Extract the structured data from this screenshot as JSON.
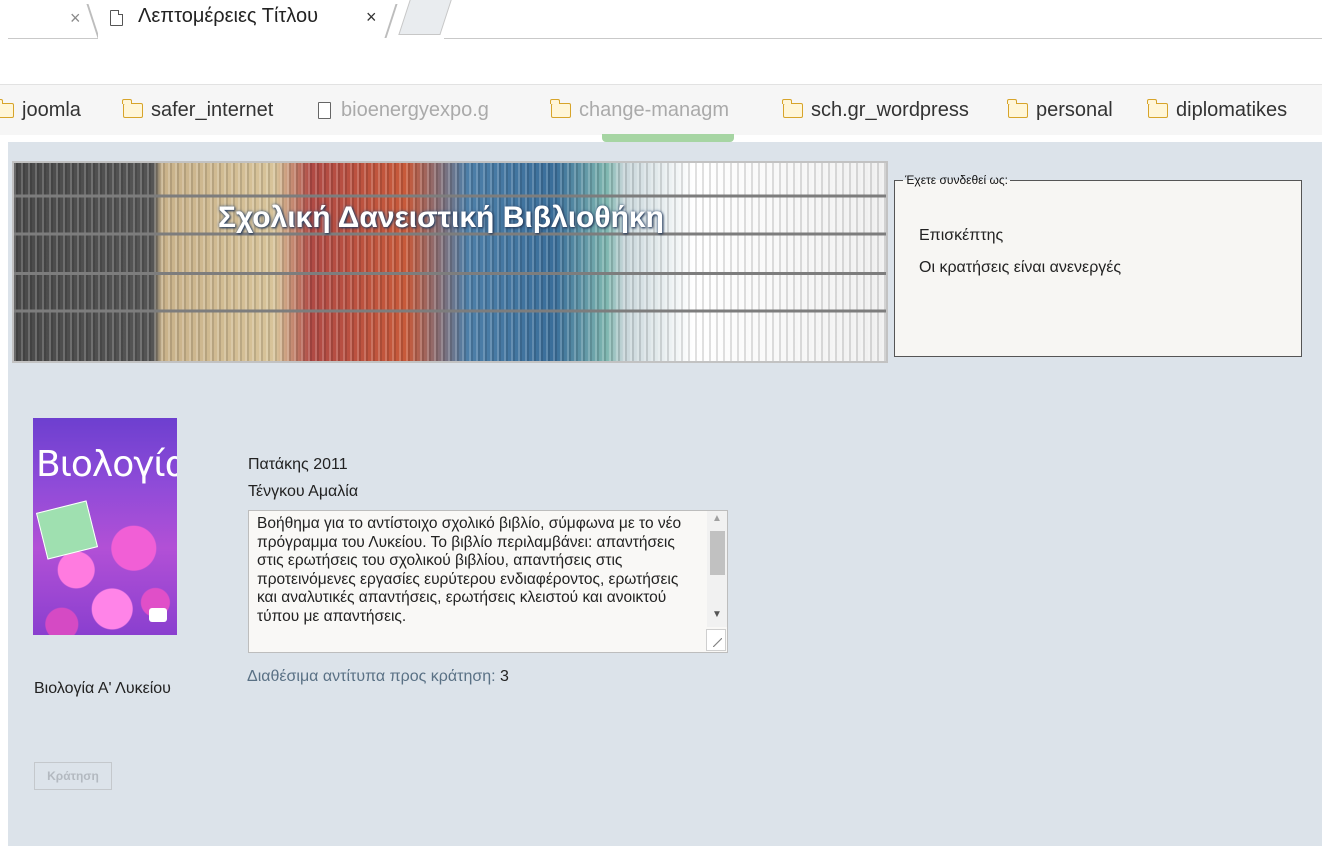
{
  "browser": {
    "active_tab_title": "Λεπτομέρειες Τίτλου",
    "close_symbol": "×",
    "bookmarks": [
      {
        "label": "joomla",
        "icon": "folder-icon"
      },
      {
        "label": "safer_internet",
        "icon": "folder-icon"
      },
      {
        "label": "bioenergyexpo.g",
        "icon": "page-icon"
      },
      {
        "label": "change-managm",
        "icon": "folder-icon"
      },
      {
        "label": "sch.gr_wordpress",
        "icon": "folder-icon"
      },
      {
        "label": "personal",
        "icon": "folder-icon"
      },
      {
        "label": "diplomatikes",
        "icon": "folder-icon"
      }
    ]
  },
  "header": {
    "site_title": "Σχολική Δανειστική Βιβλιοθήκη"
  },
  "login_box": {
    "legend": "Έχετε συνδεθεί ως:",
    "user": "Επισκέπτης",
    "reservations_status": "Οι κρατήσεις είναι ανενεργές"
  },
  "book": {
    "cover_title": "Βιολογία",
    "title": "Βιολογία Α' Λυκείου",
    "publisher_year": "Πατάκης 2011",
    "author": "Τένγκου Αμαλία",
    "description": "Βοήθημα για το αντίστοιχο σχολικό βιβλίο, σύμφωνα με το νέο πρόγραμμα του Λυκείου. Το βιβλίο περιλαμβάνει: απαντήσεις στις ερωτήσεις του σχολικού βιβλίου, απαντήσεις στις προτεινόμενες εργασίες ευρύτερου ενδιαφέροντος, ερωτήσεις και αναλυτικές απαντήσεις, ερωτήσεις κλειστού και ανοικτού τύπου με απαντήσεις.",
    "available_label": "Διαθέσιμα αντίτυπα προς κράτηση:",
    "available_count": "3",
    "reserve_button": "Κράτηση"
  },
  "colors": {
    "page_background": "#dce3ea",
    "link_text": "#5a7185",
    "folder_icon": "#d7a42a"
  }
}
